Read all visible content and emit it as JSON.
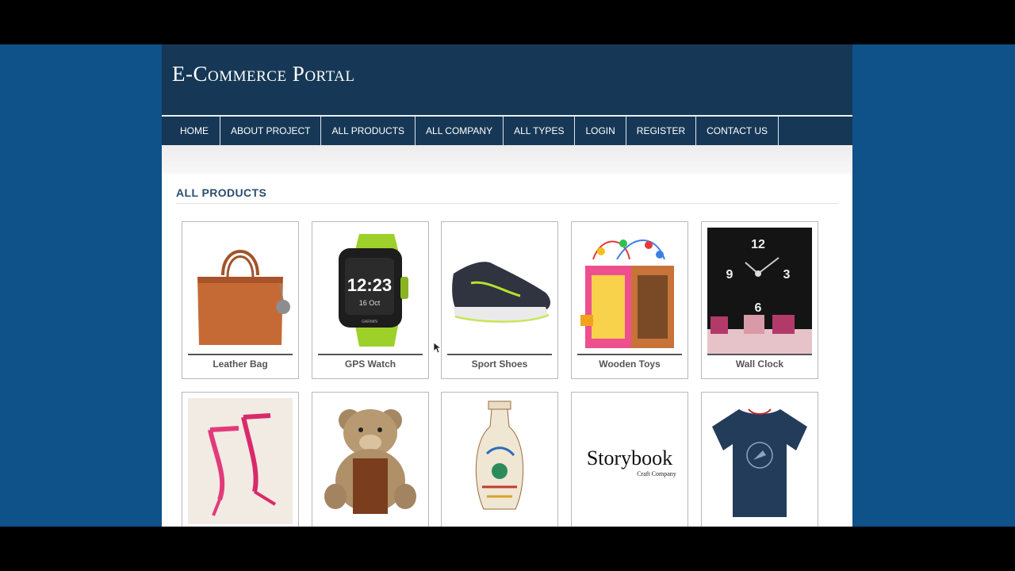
{
  "site": {
    "title": "E-Commerce Portal"
  },
  "nav": {
    "items": [
      "HOME",
      "ABOUT PROJECT",
      "ALL PRODUCTS",
      "ALL COMPANY",
      "ALL TYPES",
      "LOGIN",
      "REGISTER",
      "CONTACT US"
    ]
  },
  "section": {
    "title": "ALL PRODUCTS"
  },
  "products": [
    {
      "name": "Leather Bag",
      "icon": "leather-bag-icon"
    },
    {
      "name": "GPS Watch",
      "icon": "gps-watch-icon",
      "watch_time": "12:23",
      "watch_date": "16 Oct",
      "watch_brand": "GARMIN"
    },
    {
      "name": "Sport Shoes",
      "icon": "sport-shoe-icon"
    },
    {
      "name": "Wooden Toys",
      "icon": "wooden-toy-icon"
    },
    {
      "name": "Wall Clock",
      "icon": "wall-clock-icon",
      "clock_numerals": [
        "12",
        "3",
        "6",
        "9"
      ]
    },
    {
      "name": "",
      "icon": "pink-heels-icon"
    },
    {
      "name": "",
      "icon": "teddy-bear-icon"
    },
    {
      "name": "",
      "icon": "painted-vase-icon"
    },
    {
      "name": "",
      "icon": "storybook-logo-icon",
      "logo_main": "Storybook",
      "logo_sub": "Craft Company"
    },
    {
      "name": "",
      "icon": "tshirt-icon"
    }
  ],
  "colors": {
    "header": "#163856",
    "outer_background": "#0f5189",
    "section_title": "#2a4e70"
  }
}
